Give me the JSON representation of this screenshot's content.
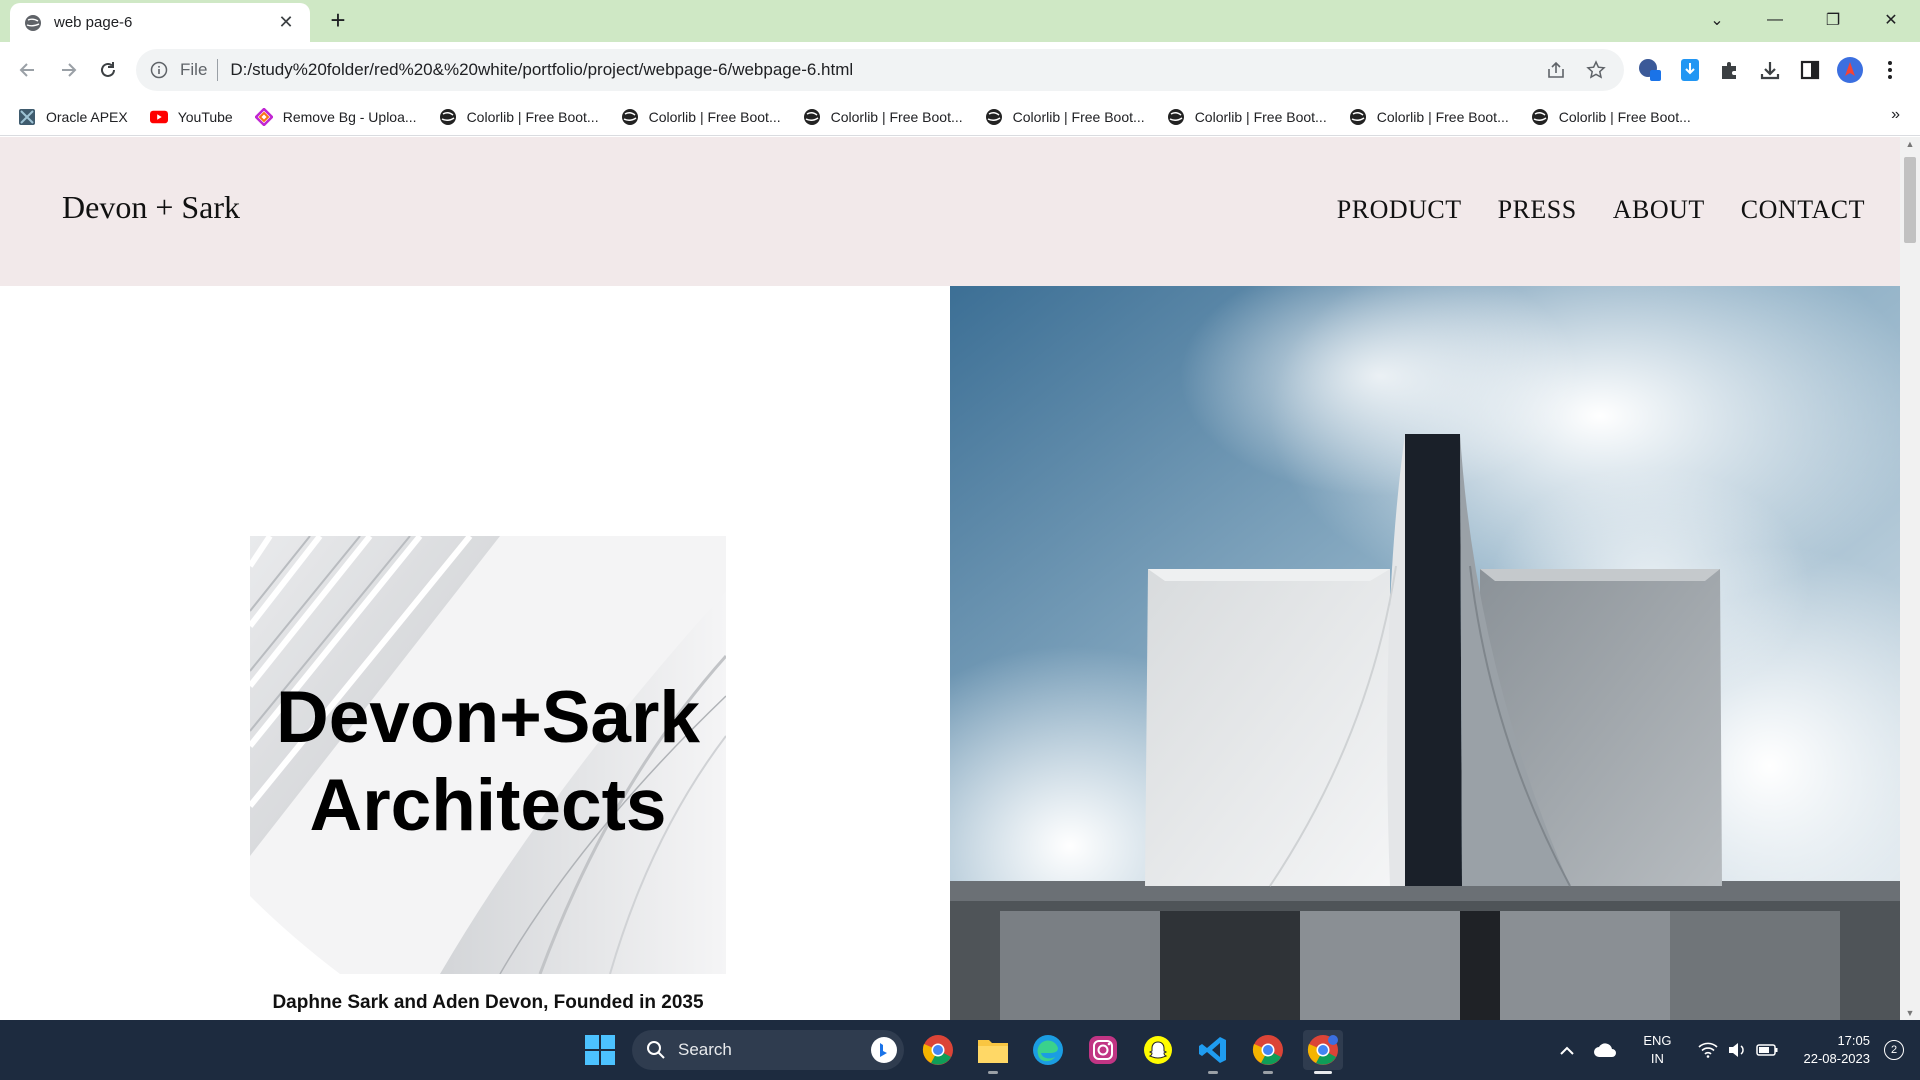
{
  "browser": {
    "tab_title": "web page-6",
    "url_scheme": "File",
    "url": "D:/study%20folder/red%20&%20white/portfolio/project/webpage-6/webpage-6.html",
    "bookmarks": [
      {
        "label": "Oracle APEX",
        "icon": "oracle-apex-icon"
      },
      {
        "label": "YouTube",
        "icon": "youtube-icon"
      },
      {
        "label": "Remove Bg - Uploa...",
        "icon": "removebg-icon"
      },
      {
        "label": "Colorlib | Free Boot...",
        "icon": "colorlib-icon"
      },
      {
        "label": "Colorlib | Free Boot...",
        "icon": "colorlib-icon"
      },
      {
        "label": "Colorlib | Free Boot...",
        "icon": "colorlib-icon"
      },
      {
        "label": "Colorlib | Free Boot...",
        "icon": "colorlib-icon"
      },
      {
        "label": "Colorlib | Free Boot...",
        "icon": "colorlib-icon"
      },
      {
        "label": "Colorlib | Free Boot...",
        "icon": "colorlib-icon"
      },
      {
        "label": "Colorlib | Free Boot...",
        "icon": "colorlib-icon"
      }
    ],
    "bookmarks_more": "»"
  },
  "site": {
    "logo": "Devon + Sark",
    "nav": [
      "PRODUCT",
      "PRESS",
      "ABOUT",
      "CONTACT"
    ],
    "hero_title_line1": "Devon+Sark",
    "hero_title_line2": "Architects",
    "hero_subtitle": "Daphne Sark and Aden Devon, Founded in 2035"
  },
  "taskbar": {
    "search_placeholder": "Search",
    "lang_line1": "ENG",
    "lang_line2": "IN",
    "time": "17:05",
    "date": "22-08-2023",
    "notification_count": "2"
  },
  "colors": {
    "tabbar_bg": "#cfe8c5",
    "site_header_bg": "#f2e9ea",
    "taskbar_bg": "#1d2b3f"
  }
}
